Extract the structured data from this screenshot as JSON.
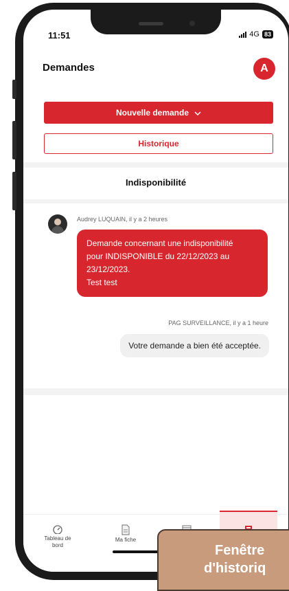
{
  "status_bar": {
    "time": "11:51",
    "network": "4G",
    "battery": "83"
  },
  "header": {
    "title": "Demandes",
    "avatar_initial": "A"
  },
  "actions": {
    "new_request_label": "Nouvelle demande",
    "history_label": "Historique"
  },
  "section": {
    "title": "Indisponibilité"
  },
  "messages": [
    {
      "author_meta": "Audrey LUQUAIN, il y a 2 heures",
      "text_lines": [
        "Demande concernant une indisponibilité",
        "pour INDISPONIBLE du 22/12/2023 au",
        "23/12/2023.",
        "Test test"
      ]
    },
    {
      "author_meta": "PAG SURVEILLANCE, il y a 1 heure",
      "text": "Votre demande a bien été acceptée."
    }
  ],
  "tabbar": {
    "items": [
      {
        "label_line1": "Tableau de",
        "label_line2": "bord",
        "icon": "gauge-icon"
      },
      {
        "label_line1": "Ma fiche",
        "label_line2": "",
        "icon": "document-icon"
      },
      {
        "label_line1": "",
        "label_line2": "",
        "icon": "calendar-icon"
      },
      {
        "label_line1": "",
        "label_line2": "",
        "icon": "requests-icon"
      }
    ]
  },
  "callout": {
    "line1": "Fenêtre",
    "line2": "d'historiq"
  },
  "colors": {
    "accent": "#d8262e",
    "callout_bg": "#c99b7d"
  }
}
